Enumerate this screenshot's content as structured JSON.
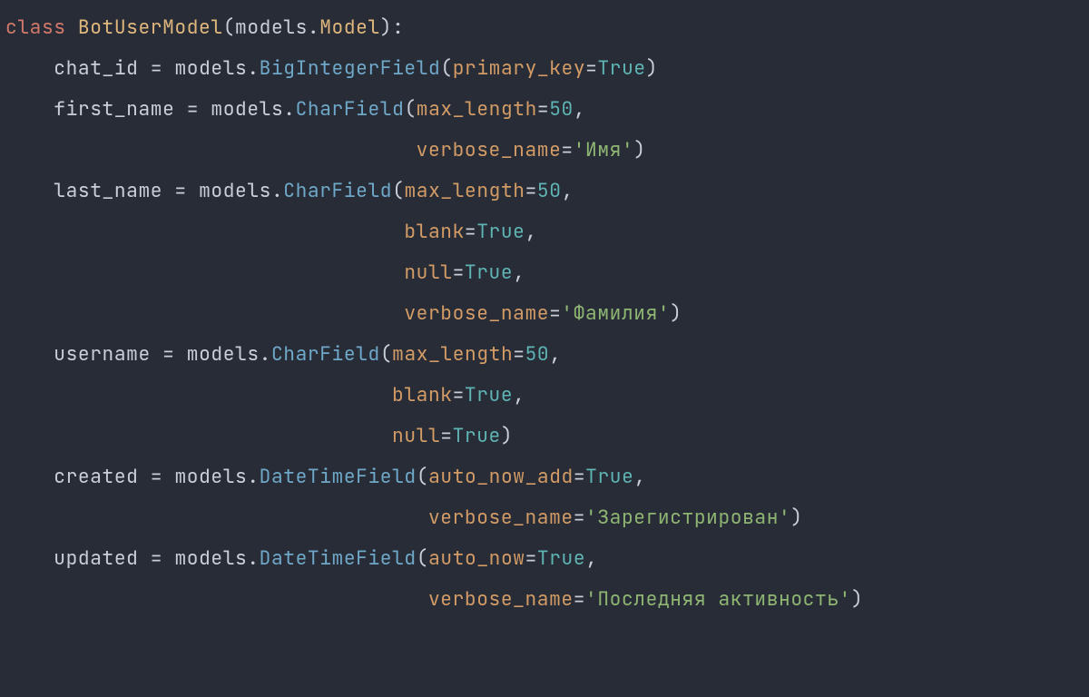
{
  "code": {
    "keyword_class": "class",
    "class_name": "BotUserModel",
    "base_module": "models",
    "base_class": "Model",
    "fields": {
      "chat_id": {
        "name": "chat_id",
        "module": "models",
        "call": "BigIntegerField",
        "kwargs": {
          "primary_key": {
            "label": "primary_key",
            "value": "True",
            "type": "bool"
          }
        }
      },
      "first_name": {
        "name": "first_name",
        "module": "models",
        "call": "CharField",
        "kwargs": {
          "max_length": {
            "label": "max_length",
            "value": "50",
            "type": "number"
          },
          "verbose_name": {
            "label": "verbose_name",
            "value": "'Имя'",
            "type": "string"
          }
        }
      },
      "last_name": {
        "name": "last_name",
        "module": "models",
        "call": "CharField",
        "kwargs": {
          "max_length": {
            "label": "max_length",
            "value": "50",
            "type": "number"
          },
          "blank": {
            "label": "blank",
            "value": "True",
            "type": "bool"
          },
          "null": {
            "label": "null",
            "value": "True",
            "type": "bool"
          },
          "verbose_name": {
            "label": "verbose_name",
            "value": "'Фамилия'",
            "type": "string"
          }
        }
      },
      "username": {
        "name": "username",
        "module": "models",
        "call": "CharField",
        "kwargs": {
          "max_length": {
            "label": "max_length",
            "value": "50",
            "type": "number"
          },
          "blank": {
            "label": "blank",
            "value": "True",
            "type": "bool"
          },
          "null": {
            "label": "null",
            "value": "True",
            "type": "bool"
          }
        }
      },
      "created": {
        "name": "created",
        "module": "models",
        "call": "DateTimeField",
        "kwargs": {
          "auto_now_add": {
            "label": "auto_now_add",
            "value": "True",
            "type": "bool"
          },
          "verbose_name": {
            "label": "verbose_name",
            "value": "'Зарегистрирован'",
            "type": "string"
          }
        }
      },
      "updated": {
        "name": "updated",
        "module": "models",
        "call": "DateTimeField",
        "kwargs": {
          "auto_now": {
            "label": "auto_now",
            "value": "True",
            "type": "bool"
          },
          "verbose_name": {
            "label": "verbose_name",
            "value": "'Последняя активность'",
            "type": "string"
          }
        }
      }
    }
  },
  "colors": {
    "background": "#272c36",
    "default": "#c9cfd7",
    "keyword": "#d1786a",
    "classname": "#e0b77d",
    "attr": "#d39b66",
    "bool": "#5fb4b4",
    "number": "#5fb4b4",
    "string": "#8fb573",
    "func": "#6fa8c9"
  }
}
